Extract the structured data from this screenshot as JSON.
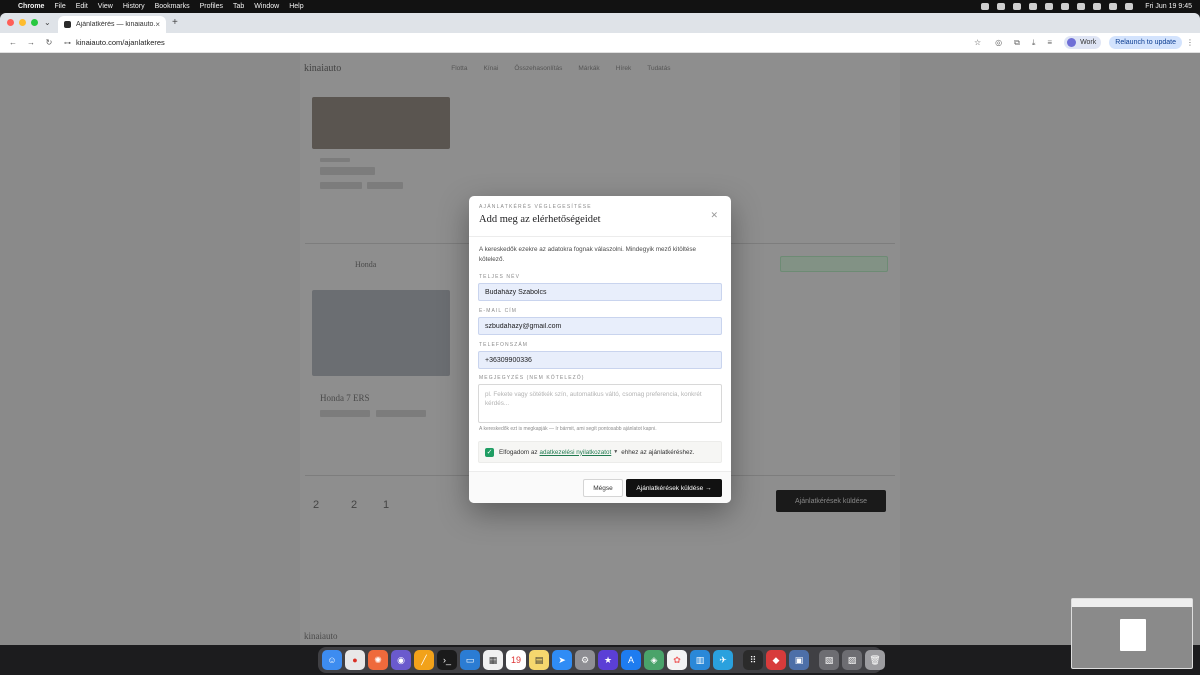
{
  "menubar": {
    "app": "Chrome",
    "items": [
      "File",
      "Edit",
      "View",
      "History",
      "Bookmarks",
      "Profiles",
      "Tab",
      "Window",
      "Help"
    ],
    "clock": "Fri Jun 19  9:45"
  },
  "browser": {
    "tab_title": "Ajánlatkérés — kinaiauto.com",
    "url": "kinaiauto.com/ajanlatkeres",
    "profile_label": "Work",
    "relaunch_label": "Relaunch to update"
  },
  "background_page": {
    "logo": "kinaiauto",
    "nav": [
      "Flotta",
      "Kínai",
      "Összehasonlítás",
      "Márkák",
      "Hírek",
      "Tudatás"
    ],
    "section_brand": "Honda",
    "car_title": "Honda 7 ERS",
    "submit_label": "Ajánlatkérések küldése",
    "stats": [
      "2",
      "2",
      "1"
    ]
  },
  "modal": {
    "eyebrow": "Ajánlatkérés véglegesítése",
    "title": "Add meg az elérhetőségeidet",
    "description": "A kereskedők ezekre az adatokra fognak válaszolni. Mindegyik mező kitöltése kötelező.",
    "fields": {
      "name_label": "Teljes név",
      "name_value": "Budaházy Szabolcs",
      "email_label": "E-mail cím",
      "email_value": "szbudahazy@gmail.com",
      "phone_label": "Telefonszám",
      "phone_value": "+36309900336",
      "note_label": "Megjegyzés (nem kötelező)",
      "note_placeholder": "pl. Fekete vagy sötétkék szín, automatikus váltó, csomag preferencia, konkrét kérdés...",
      "note_hint": "A kereskedők ezt is megkapják — ír bármit, ami segít pontosabb ajánlatot kapni."
    },
    "consent": {
      "prefix": "Elfogadom az",
      "link": "adatkezelési nyilatkozatot",
      "suffix": "ehhez az ajánlatkéréshez."
    },
    "cancel_label": "Mégse",
    "submit_label": "Ajánlatkérések küldése  →"
  },
  "colors": {
    "accent_green": "#1f9d63",
    "submit_black": "#111111",
    "input_fill": "#e8eefb"
  }
}
